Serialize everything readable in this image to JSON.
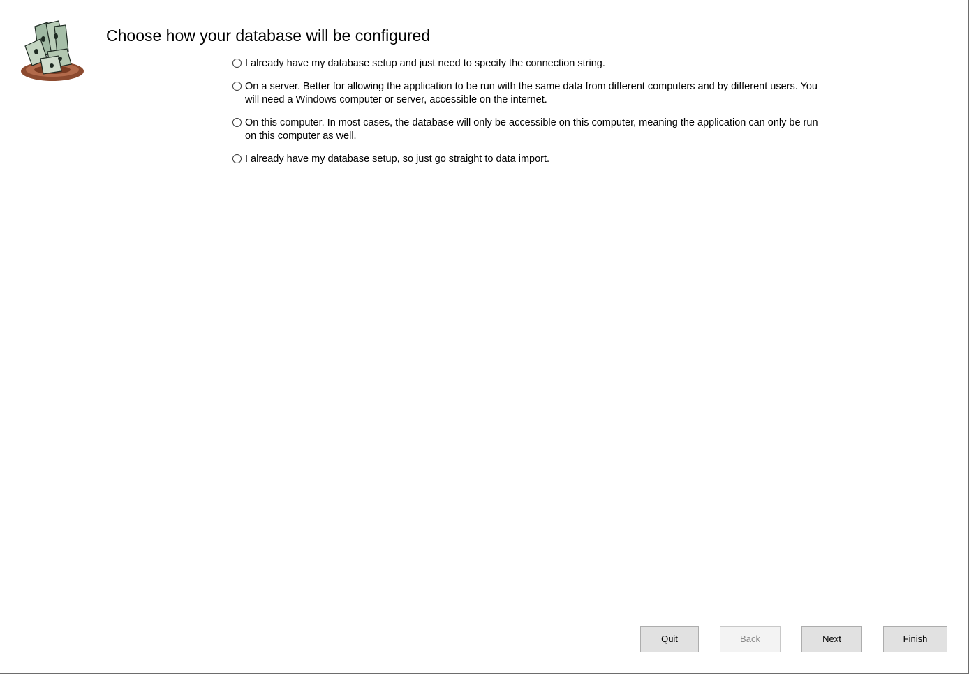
{
  "header": {
    "title": "Choose how your database will be configured",
    "logo_icon": "money-stack-logo-icon"
  },
  "options": [
    {
      "label": "I already have my database setup and just need to specify the connection string.",
      "selected": false
    },
    {
      "label": "On a server. Better for allowing the application to be run with the same data from different computers and by different users. You will need a Windows computer or server, accessible on the internet.",
      "selected": false
    },
    {
      "label": "On this computer. In most cases, the database will only be accessible on this computer, meaning the application can only be run on this computer as well.",
      "selected": false
    },
    {
      "label": "I already have my database setup, so just go straight to data import.",
      "selected": false
    }
  ],
  "buttons": {
    "quit": "Quit",
    "back": "Back",
    "next": "Next",
    "finish": "Finish"
  }
}
